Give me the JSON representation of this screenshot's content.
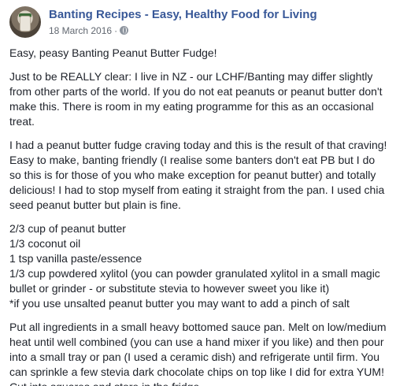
{
  "post": {
    "page_name": "Banting Recipes - Easy, Healthy Food for Living",
    "date": "18 March 2016",
    "separator": "·",
    "privacy_icon": "globe-icon",
    "title_line": "Easy, peasy Banting Peanut Butter Fudge!",
    "paragraph_clear": "Just to be REALLY clear: I live in NZ - our LCHF/Banting may differ slightly from other parts of the world. If you do not eat peanuts or peanut butter don't make this. There is room in my eating programme for this as an occasional treat.",
    "paragraph_craving": "I had a peanut butter fudge craving today and this is the result of that craving! Easy to make, banting friendly (I realise some banters don't eat PB but I do so this is for those of you who make exception for peanut butter) and totally delicious! I had to stop myself from eating it straight from the pan. I used chia seed peanut butter but plain is fine.",
    "ingredients": [
      "2/3 cup of peanut butter",
      "1/3 coconut oil",
      "1 tsp vanilla paste/essence",
      "1/3 cup powdered xylitol (you can powder granulated xylitol in a small magic bullet or grinder - or substitute stevia to however sweet you like it)",
      "*if you use unsalted peanut butter you may want to add a pinch of salt"
    ],
    "paragraph_method": "Put all ingredients in a small heavy bottomed sauce pan. Melt on low/medium heat until well combined (you can use a hand mixer if you like) and then pour into a small tray or pan (I used a ceramic dish) and refrigerate until firm. You can sprinkle a few stevia dark chocolate chips on top like I did for extra YUM! Cut into squares and store in the fridge."
  }
}
